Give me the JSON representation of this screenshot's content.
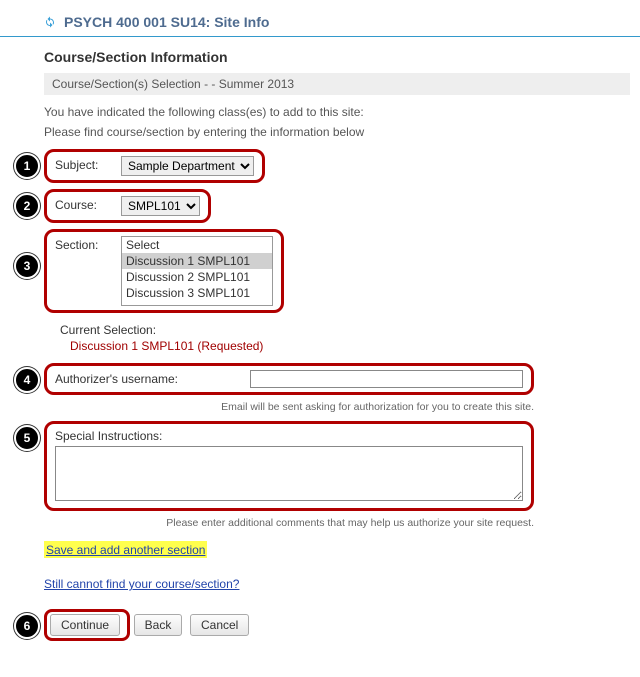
{
  "header": {
    "title": "PSYCH 400 001 SU14: Site Info"
  },
  "heading": "Course/Section Information",
  "selection_bar": "Course/Section(s) Selection - - Summer 2013",
  "intro": "You have indicated the following class(es) to add to this site:",
  "hint": "Please find course/section by entering the information below",
  "steps": {
    "s1": "1",
    "s2": "2",
    "s3": "3",
    "s4": "4",
    "s5": "5",
    "s6": "6"
  },
  "subject": {
    "label": "Subject:",
    "selected": "Sample Department"
  },
  "course": {
    "label": "Course:",
    "selected": "SMPL101"
  },
  "section": {
    "label": "Section:",
    "options": {
      "o0": "Select",
      "o1": "Discussion 1 SMPL101",
      "o2": "Discussion 2 SMPL101",
      "o3": "Discussion 3 SMPL101"
    }
  },
  "current_selection": {
    "label": "Current Selection:",
    "value": "Discussion 1 SMPL101 (Requested)"
  },
  "authorizer": {
    "label": "Authorizer's username:",
    "value": "",
    "note": "Email will be sent asking for authorization for you to create this site."
  },
  "special": {
    "label": "Special Instructions:",
    "value": "",
    "note": "Please enter additional comments that may help us authorize your site request."
  },
  "links": {
    "save_add": "Save and add another section",
    "still_cannot": "Still cannot find your course/section?"
  },
  "buttons": {
    "continue_label": "Continue",
    "back_label": "Back",
    "cancel_label": "Cancel"
  }
}
